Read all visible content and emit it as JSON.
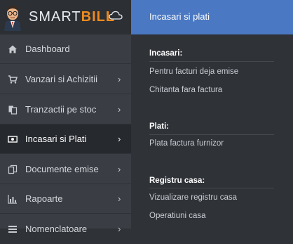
{
  "brand": {
    "name_part1": "SMART",
    "name_part2": "BILL"
  },
  "sidebar": {
    "items": [
      {
        "label": "Dashboard",
        "icon": "home-icon"
      },
      {
        "label": "Vanzari si Achizitii",
        "icon": "cart-icon"
      },
      {
        "label": "Tranzactii pe stoc",
        "icon": "documents-icon"
      },
      {
        "label": "Incasari si Plati",
        "icon": "banknote-icon"
      },
      {
        "label": "Documente emise",
        "icon": "copy-icon"
      },
      {
        "label": "Rapoarte",
        "icon": "bar-chart-icon"
      },
      {
        "label": "Nomenclatoare",
        "icon": "list-icon"
      }
    ],
    "chevron": "›"
  },
  "panel": {
    "title": "Incasari si plati",
    "sections": [
      {
        "title": "Incasari:",
        "links": [
          "Pentru facturi deja emise",
          "Chitanta fara factura"
        ]
      },
      {
        "title": "Plati:",
        "links": [
          "Plata factura furnizor"
        ]
      },
      {
        "title": "Registru casa:",
        "links": [
          "Vizualizare registru casa",
          "Operatiuni casa"
        ]
      }
    ]
  },
  "colors": {
    "accent": "#4a78c2",
    "brand_orange": "#ef8b1e",
    "sidebar_bg": "#3a3e44",
    "panel_bg": "#2f3237"
  }
}
